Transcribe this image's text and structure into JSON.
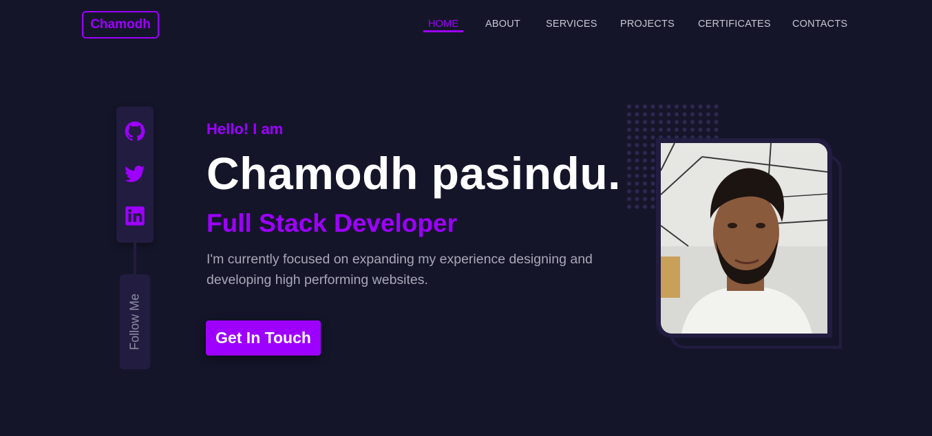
{
  "header": {
    "logo_text": "Chamodh",
    "nav": [
      {
        "label": "HOME",
        "active": true
      },
      {
        "label": "ABOUT",
        "active": false
      },
      {
        "label": "SERVICES",
        "active": false
      },
      {
        "label": "PROJECTS",
        "active": false
      },
      {
        "label": "CERTIFICATES",
        "active": false
      },
      {
        "label": "CONTACTS",
        "active": false
      }
    ]
  },
  "social": {
    "icons": [
      "github-icon",
      "twitter-icon",
      "linkedin-icon"
    ],
    "follow_label": "Follow Me"
  },
  "hero": {
    "greeting": "Hello! I am",
    "name": "Chamodh pasindu.",
    "role": "Full Stack Developer",
    "description": "I'm currently focused on expanding my experience designing and developing high performing websites.",
    "cta_label": "Get In Touch"
  },
  "colors": {
    "background": "#15152a",
    "accent": "#9d00ff",
    "panel": "#221c40",
    "text_primary": "#ffffff",
    "text_muted": "#a8a8b8"
  }
}
